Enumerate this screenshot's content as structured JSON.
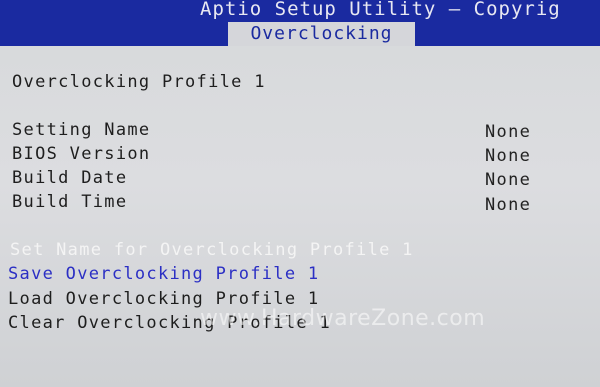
{
  "header": {
    "title": "Aptio Setup Utility – Copyrig",
    "active_tab": "Overclocking"
  },
  "main": {
    "section_title": "Overclocking Profile 1",
    "info_rows": [
      {
        "label": "Setting Name",
        "value": "None"
      },
      {
        "label": "BIOS Version",
        "value": "None"
      },
      {
        "label": "Build Date",
        "value": "None"
      },
      {
        "label": "Build Time",
        "value": "None"
      }
    ],
    "menu_items": [
      {
        "label": "Set Name for Overclocking Profile 1"
      },
      {
        "label": "Save Overclocking Profile 1"
      },
      {
        "label": "Load Overclocking Profile 1"
      },
      {
        "label": "Clear Overclocking Profile 1"
      }
    ]
  },
  "watermark": "www.HardwareZone.com",
  "colors": {
    "header_bg": "#1a2aa0",
    "content_bg": "#d3d5d8",
    "highlight": "#2b2fc4",
    "disabled_text": "#f4f4f4"
  }
}
